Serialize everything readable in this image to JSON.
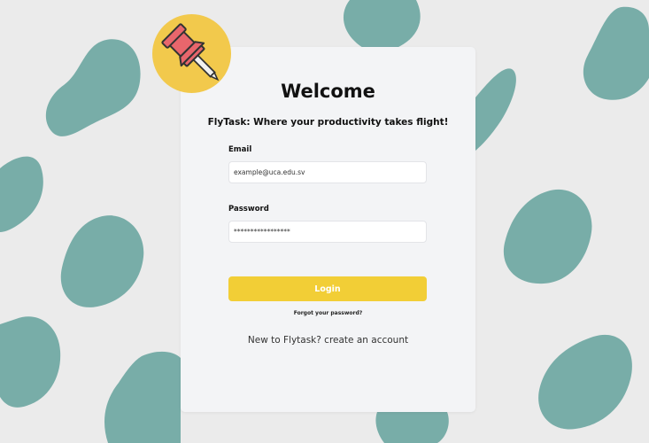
{
  "colors": {
    "background": "#ebebeb",
    "blob": "#78ada8",
    "card": "#f3f4f6",
    "accent": "#f2ce36",
    "badge": "#f2c94c",
    "pin_red": "#e8666c"
  },
  "badge": {
    "icon": "pushpin-icon"
  },
  "login": {
    "title": "Welcome",
    "subtitle": "FlyTask: Where your productivity takes flight!",
    "email_label": "Email",
    "email_value": "example@uca.edu.sv",
    "password_label": "Password",
    "password_value": "*****************",
    "login_button": "Login",
    "forgot_password": "Forgot your password?",
    "register_link": "New to Flytask? create an account"
  }
}
